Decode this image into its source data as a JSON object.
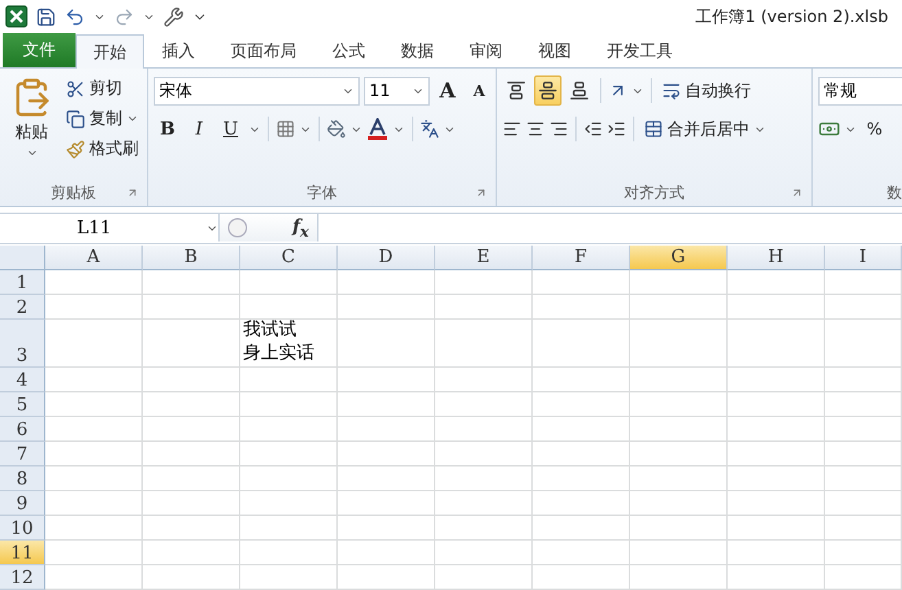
{
  "window": {
    "title": "工作簿1 (version 2).xlsb"
  },
  "file_tab": "文件",
  "tabs": [
    {
      "label": "开始",
      "selected": true
    },
    {
      "label": "插入",
      "selected": false
    },
    {
      "label": "页面布局",
      "selected": false
    },
    {
      "label": "公式",
      "selected": false
    },
    {
      "label": "数据",
      "selected": false
    },
    {
      "label": "审阅",
      "selected": false
    },
    {
      "label": "视图",
      "selected": false
    },
    {
      "label": "开发工具",
      "selected": false
    }
  ],
  "ribbon": {
    "clipboard": {
      "paste": "粘贴",
      "cut": "剪切",
      "copy": "复制",
      "format_painter": "格式刷",
      "label": "剪贴板"
    },
    "font": {
      "name": "宋体",
      "size": "11",
      "grow": "A",
      "shrink": "A",
      "bold": "B",
      "italic": "I",
      "underline": "U",
      "label": "字体"
    },
    "alignment": {
      "vertical": [
        {
          "selected": false
        },
        {
          "selected": true
        },
        {
          "selected": false
        }
      ],
      "wrap_text": "自动换行",
      "merge_center": "合并后居中",
      "label": "对齐方式"
    },
    "number": {
      "format": "常规",
      "percent": "%",
      "label": "数"
    }
  },
  "formula_bar": {
    "name_box": "L11",
    "function_label": "f$_{x}$"
  },
  "sheet": {
    "columns": [
      {
        "label": "A",
        "selected": false
      },
      {
        "label": "B",
        "selected": false
      },
      {
        "label": "C",
        "selected": false
      },
      {
        "label": "D",
        "selected": false
      },
      {
        "label": "E",
        "selected": false
      },
      {
        "label": "F",
        "selected": false
      },
      {
        "label": "G",
        "selected": true
      },
      {
        "label": "H",
        "selected": false
      },
      {
        "label": "I",
        "selected": false
      }
    ],
    "rows": [
      {
        "label": "1",
        "selected": false
      },
      {
        "label": "2",
        "selected": false
      },
      {
        "label": "3",
        "selected": false,
        "cells": [
          {
            "kind": "empty"
          },
          {
            "kind": "empty"
          },
          {
            "kind": "text",
            "lines": [
              "我试试",
              "身上实话"
            ]
          }
        ]
      },
      {
        "label": "4",
        "selected": false
      },
      {
        "label": "5",
        "selected": false
      },
      {
        "label": "6",
        "selected": false
      },
      {
        "label": "7",
        "selected": false
      },
      {
        "label": "8",
        "selected": false
      },
      {
        "label": "9",
        "selected": false
      },
      {
        "label": "10",
        "selected": false
      },
      {
        "label": "11",
        "selected": true
      },
      {
        "label": "12",
        "selected": false
      }
    ]
  }
}
